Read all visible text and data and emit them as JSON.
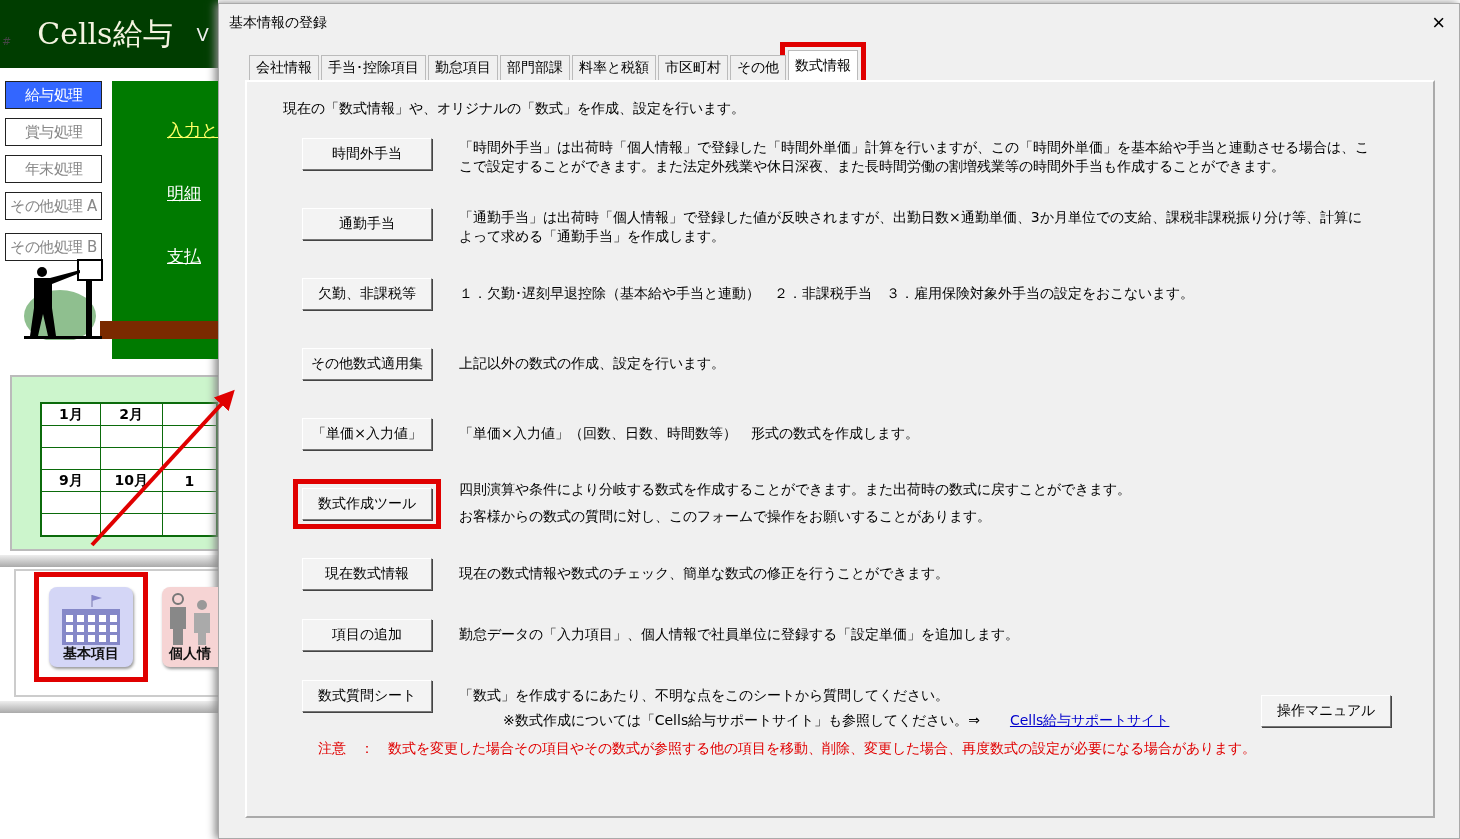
{
  "app": {
    "mark": "#",
    "title": "Cells給与",
    "version": "V",
    "nav": [
      {
        "label": "給与処理",
        "selected": true
      },
      {
        "label": "賞与処理",
        "selected": false
      },
      {
        "label": "年末処理",
        "selected": false
      },
      {
        "label": "その他処理 A",
        "selected": false
      },
      {
        "label": "その他処理 B",
        "selected": false
      }
    ],
    "links": [
      {
        "label": "入力と",
        "kind": "accent"
      },
      {
        "label": "明細",
        "kind": "plain"
      },
      {
        "label": "支払",
        "kind": "plain"
      }
    ],
    "calendar": [
      [
        "1月",
        "2月"
      ],
      [
        "9月",
        "10月",
        "1"
      ]
    ],
    "tiles": [
      {
        "label": "基本項目",
        "kind": "building",
        "highlighted": true
      },
      {
        "label": "個人情",
        "kind": "people",
        "highlighted": false
      }
    ]
  },
  "dialog": {
    "title": "基本情報の登録",
    "close": "×",
    "tabs": [
      {
        "label": "会社情報",
        "selected": false,
        "highlighted": false
      },
      {
        "label": "手当･控除項目",
        "selected": false,
        "highlighted": false
      },
      {
        "label": "勤怠項目",
        "selected": false,
        "highlighted": false
      },
      {
        "label": "部門部課",
        "selected": false,
        "highlighted": false
      },
      {
        "label": "料率と税額",
        "selected": false,
        "highlighted": false
      },
      {
        "label": "市区町村",
        "selected": false,
        "highlighted": false
      },
      {
        "label": "その他",
        "selected": false,
        "highlighted": false
      },
      {
        "label": "数式情報",
        "selected": true,
        "highlighted": true
      }
    ],
    "intro": "現在の「数式情報」や、オリジナルの「数式」を作成、設定を行います。",
    "rows": [
      {
        "button": "時間外手当",
        "highlighted": false,
        "lines": [
          "「時間外手当」は出荷時「個人情報」で登録した「時間外単価」計算を行いますが、この「時間外単価」を基本給や手当と連動させる場合は、ここで設定することができます。また法定外残業や休日深夜、また長時間労働の割増残業等の時間外手当も作成することができます。"
        ]
      },
      {
        "button": "通勤手当",
        "highlighted": false,
        "lines": [
          "「通勤手当」は出荷時「個人情報」で登録した値が反映されますが、出勤日数×通勤単価、3か月単位での支給、課税非課税振り分け等、計算によって求める「通勤手当」を作成します。"
        ]
      },
      {
        "button": "欠勤、非課税等",
        "highlighted": false,
        "lines": [
          "１．欠勤･遅刻早退控除（基本給や手当と連動）　２．非課税手当　３．雇用保険対象外手当の設定をおこないます。"
        ]
      },
      {
        "button": "その他数式適用集",
        "highlighted": false,
        "lines": [
          "上記以外の数式の作成、設定を行います。"
        ]
      },
      {
        "button": "「単価×入力値」",
        "highlighted": false,
        "lines": [
          "「単価×入力値」（回数、日数、時間数等）　形式の数式を作成します。"
        ]
      },
      {
        "button": "数式作成ツール",
        "highlighted": true,
        "lines": [
          "四則演算や条件により分岐する数式を作成することができます。また出荷時の数式に戻すことができます。",
          "お客様からの数式の質問に対し、このフォームで操作をお願いすることがあります。"
        ]
      },
      {
        "button": "現在数式情報",
        "highlighted": false,
        "lines": [
          "現在の数式情報や数式のチェック、簡単な数式の修正を行うことができます。"
        ]
      },
      {
        "button": "項目の追加",
        "highlighted": false,
        "lines": [
          "勤怠データの「入力項目」、個人情報で社員単位に登録する「設定単価」を追加します。"
        ]
      },
      {
        "button": "数式質問シート",
        "highlighted": false,
        "lines": [
          "「数式」を作成するにあたり、不明な点をこのシートから質問してください。"
        ]
      }
    ],
    "support_note": "※数式作成については「Cells給与サポートサイト」も参照してください。⇒",
    "support_link": "Cells給与サポートサイト",
    "manual_button": "操作マニュアル",
    "warning": "注意　：　数式を変更した場合その項目やその数式が参照する他の項目を移動、削除、変更した場合、再度数式の設定が必要になる場合があります。"
  }
}
